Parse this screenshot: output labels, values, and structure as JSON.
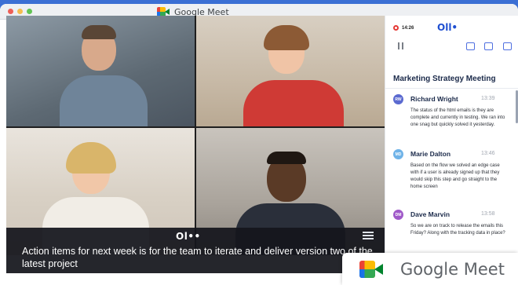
{
  "window": {
    "title": "Google Meet",
    "app_icon": "google-meet-icon"
  },
  "captions": {
    "brand": "Ol••",
    "text": "Action items for next week is for the team to iterate and deliver version two of the latest project"
  },
  "panel": {
    "recording_time": "14:26",
    "brand": "Oll•",
    "meeting_title": "Marketing Strategy Meeting",
    "entries": [
      {
        "initials": "RW",
        "speaker": "Richard Wright",
        "time": "13:39",
        "color": "#5b6ad0",
        "text": "The status of the html emails is they are complete and currently in testing. We ran into one snag but quickly solved it yesterday."
      },
      {
        "initials": "MD",
        "speaker": "Marie Dalton",
        "time": "13:46",
        "color": "#6fb3e8",
        "text": "Based on the flow we solved an edge case with if a user is already signed up that they would skip this step and go straight to the home screen"
      },
      {
        "initials": "DM",
        "speaker": "Dave Marvin",
        "time": "13:58",
        "color": "#a05ac9",
        "text": "So we are on track to release the emails this Friday? Along with the tracking data in place?"
      }
    ]
  },
  "badge": {
    "text": "Google Meet"
  }
}
